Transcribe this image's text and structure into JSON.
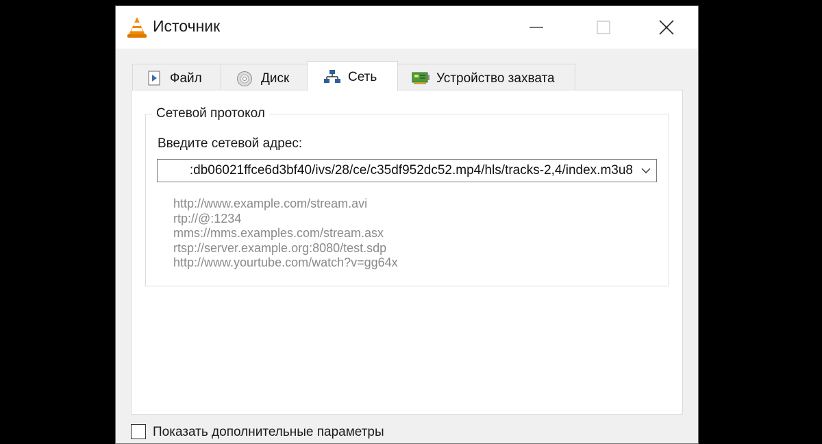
{
  "window": {
    "title": "Источник",
    "icon": "vlc-cone-icon"
  },
  "tabs": [
    {
      "label": "Файл",
      "icon": "file-icon",
      "active": false
    },
    {
      "label": "Диск",
      "icon": "disc-icon",
      "active": false
    },
    {
      "label": "Сеть",
      "icon": "network-icon",
      "active": true
    },
    {
      "label": "Устройство захвата",
      "icon": "capture-card-icon",
      "active": false
    }
  ],
  "network": {
    "group_title": "Сетевой протокол",
    "address_label": "Введите сетевой адрес:",
    "address_value": ":db06021ffce6d3bf40/ivs/28/ce/c35df952dc52.mp4/hls/tracks-2,4/index.m3u8",
    "examples": [
      "http://www.example.com/stream.avi",
      "rtp://@:1234",
      "mms://mms.examples.com/stream.asx",
      "rtsp://server.example.org:8080/test.sdp",
      "http://www.yourtube.com/watch?v=gg64x"
    ]
  },
  "bottom": {
    "checkbox_label": "Показать дополнительные параметры",
    "checked": false
  },
  "colors": {
    "accent_orange": "#f08a00",
    "example_text": "#8a8a8a",
    "window_bg": "#f0f0f0",
    "page_bg": "#000000"
  }
}
